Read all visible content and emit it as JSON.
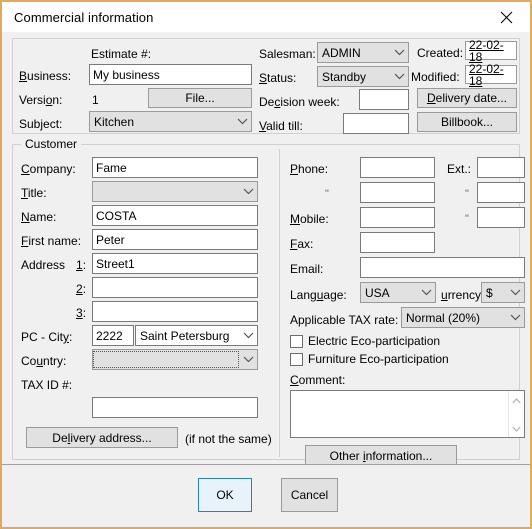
{
  "window": {
    "title": "Commercial information",
    "close_icon": "close-icon"
  },
  "header_section": {
    "estimate_label": "Estimate #:",
    "business_label": "Business:",
    "business_value": "My business",
    "version_label": "Version:",
    "version_value": "1",
    "file_button": "File...",
    "subject_label": "Subject:",
    "subject_value": "Kitchen",
    "salesman_label": "Salesman:",
    "salesman_value": "ADMIN",
    "status_label": "Status:",
    "status_value": "Standby",
    "decision_week_label": "Decision week:",
    "decision_week_value": "",
    "valid_till_label": "Valid till:",
    "valid_till_value": "",
    "created_label": "Created:",
    "created_value": "22-02-18",
    "modified_label": "Modified:",
    "modified_value": "22-02-18",
    "delivery_date_button": "Delivery date...",
    "billbook_button": "Billbook..."
  },
  "customer": {
    "legend": "Customer",
    "company_label": "Company:",
    "company_value": "Fame",
    "title_label": "Title:",
    "title_value": "",
    "name_label": "Name:",
    "name_value": "COSTA",
    "first_name_label": "First name:",
    "first_name_value": "Peter",
    "address_label": "Address",
    "address_1_label": "1:",
    "address_1_value": "Street1",
    "address_2_label": "2:",
    "address_2_value": "",
    "address_3_label": "3:",
    "address_3_value": "",
    "pc_city_label": "PC - City:",
    "pc_value": "2222",
    "city_value": "Saint Petersburg",
    "country_label": "Country:",
    "country_value": "",
    "tax_id_label": "TAX ID #:",
    "tax_id_value": "",
    "delivery_address_button": "Delivery address...",
    "delivery_address_hint": "(if not the same)",
    "phone_label": "Phone:",
    "phone_value": "",
    "phone2_label": "\"",
    "phone2_value": "",
    "mobile_label": "Mobile:",
    "mobile_value": "",
    "fax_label": "Fax:",
    "fax_value": "",
    "email_label": "Email:",
    "email_value": "",
    "ext_label": "Ext.:",
    "ext_value": "",
    "ext2_label": "\"",
    "ext2_value": "",
    "ext3_label": "\"",
    "ext3_value": "",
    "language_label": "Language:",
    "language_value": "USA",
    "currency_label": "urrency:",
    "currency_value": "$",
    "tax_rate_label": "Applicable TAX rate:",
    "tax_rate_value": "Normal (20%)",
    "electric_eco_label": "Electric Eco-participation",
    "furniture_eco_label": "Furniture Eco-participation",
    "comment_label": "Comment:",
    "comment_value": "",
    "other_information_button": "Other information..."
  },
  "footer": {
    "ok_label": "OK",
    "cancel_label": "Cancel"
  },
  "colors": {
    "window_border": "#e0aa5e",
    "dialog_bg": "#f0f0f0",
    "default_button_border": "#2a7fbd",
    "default_button_bg": "#e8f2fb"
  }
}
